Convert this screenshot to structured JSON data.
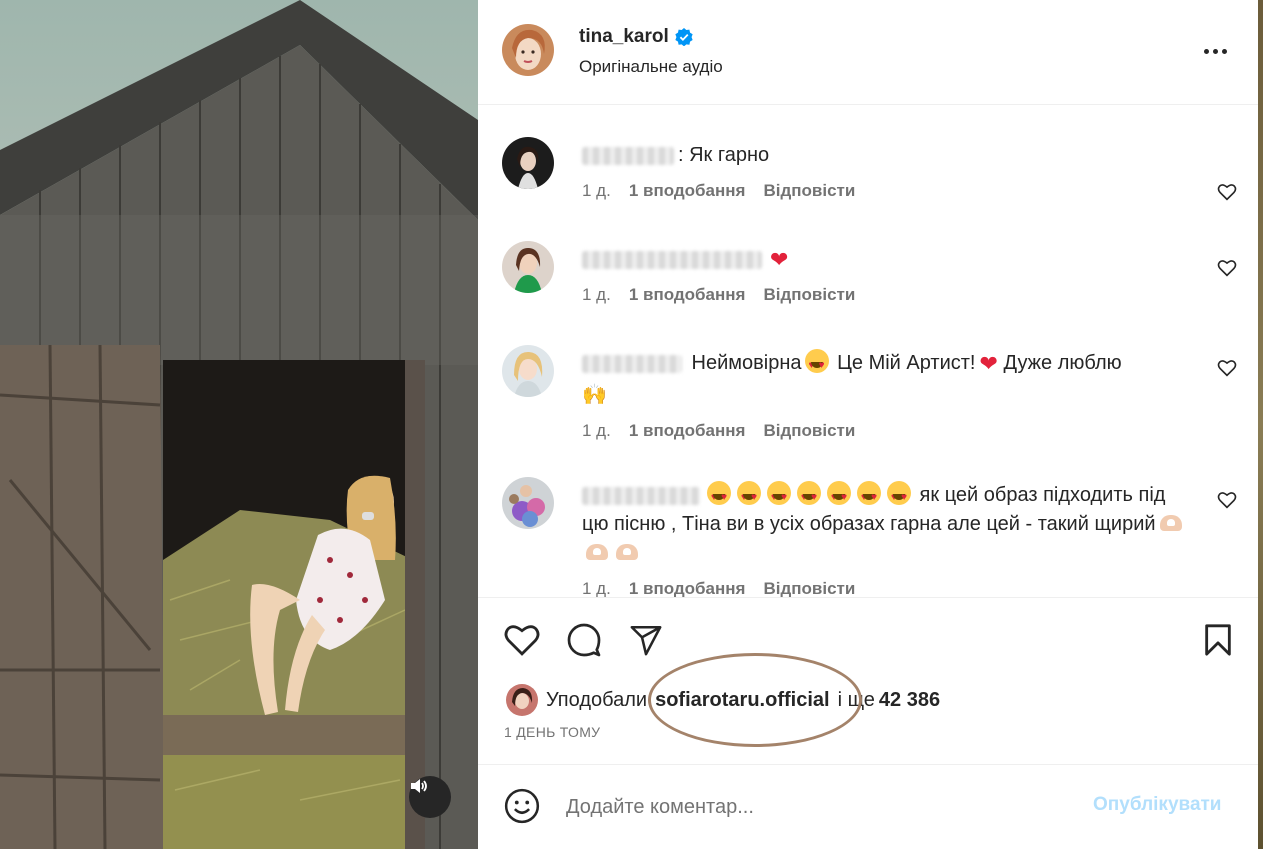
{
  "post": {
    "username": "tina_karol",
    "audio_label": "Оригінальне аудіо",
    "verified": true
  },
  "comments": [
    {
      "text": ": Як гарно",
      "time": "1 д.",
      "likes": "1 вподобання",
      "reply": "Відповісти"
    },
    {
      "text": "",
      "time": "1 д.",
      "likes": "1 вподобання",
      "reply": "Відповісти"
    },
    {
      "text_a": " Неймовірна",
      "text_b": " Це Мій Артист!",
      "text_c": " Дуже люблю",
      "time": "1 д.",
      "likes": "1 вподобання",
      "reply": "Відповісти"
    },
    {
      "text_a": " як цей образ підходить під цю пісню , Тіна ви в усіх образах гарна але цей - такий щирий",
      "time": "1 д.",
      "likes": "1 вподобання",
      "reply": "Відповісти"
    }
  ],
  "likes": {
    "prefix": "Уподобали",
    "user": "sofiarotaru.official",
    "suffix": "і ще",
    "count": "42 386"
  },
  "date": "1 ДЕНЬ ТОМУ",
  "composer": {
    "placeholder": "Додайте коментар...",
    "publish": "Опублікувати"
  },
  "icons": {
    "more": "more-options-icon",
    "like": "heart-icon",
    "comment": "comment-icon",
    "share": "share-icon",
    "save": "bookmark-icon",
    "emoji": "emoji-icon",
    "audio": "speaker-icon"
  },
  "colors": {
    "verified": "#0095f6",
    "publish_disabled": "#b2dffc",
    "annotation_oval": "#a4836a"
  }
}
